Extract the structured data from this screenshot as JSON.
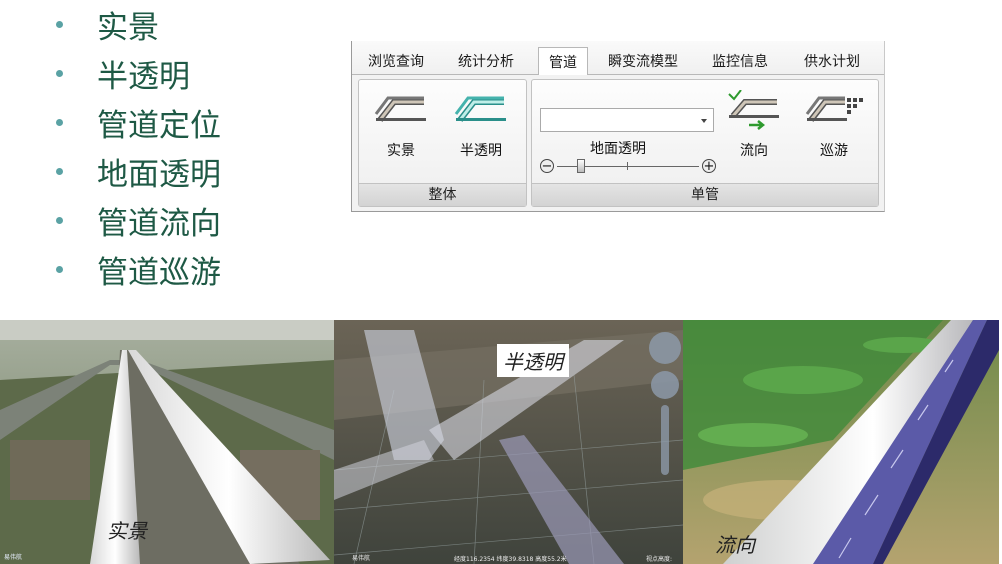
{
  "bullets": [
    "实景",
    "半透明",
    "管道定位",
    "地面透明",
    "管道流向",
    "管道巡游"
  ],
  "ribbon": {
    "tabs": [
      "浏览查询",
      "统计分析",
      "管道",
      "瞬变流模型",
      "监控信息",
      "供水计划"
    ],
    "active_tab": "管道",
    "group_whole": {
      "label": "整体",
      "buttons": [
        "实景",
        "半透明"
      ]
    },
    "group_single": {
      "label": "单管",
      "combo_value": "",
      "slider_label": "地面透明",
      "slider_minus": "−",
      "slider_plus": "+",
      "slider_value": 0.15,
      "buttons": [
        "流向",
        "巡游"
      ]
    }
  },
  "photos": [
    {
      "caption": "实景",
      "watermark": "易伟航"
    },
    {
      "caption": "半透明",
      "watermark": "易伟航",
      "status": "经度116.2354 纬度39.8318 高度55.2米",
      "status_right": "视点高度:"
    },
    {
      "caption": "流向"
    }
  ],
  "colors": {
    "bullet_text": "#1e5945",
    "bullet_dot": "#5aa2a4",
    "pipe_flow": "#5b5aa8"
  }
}
